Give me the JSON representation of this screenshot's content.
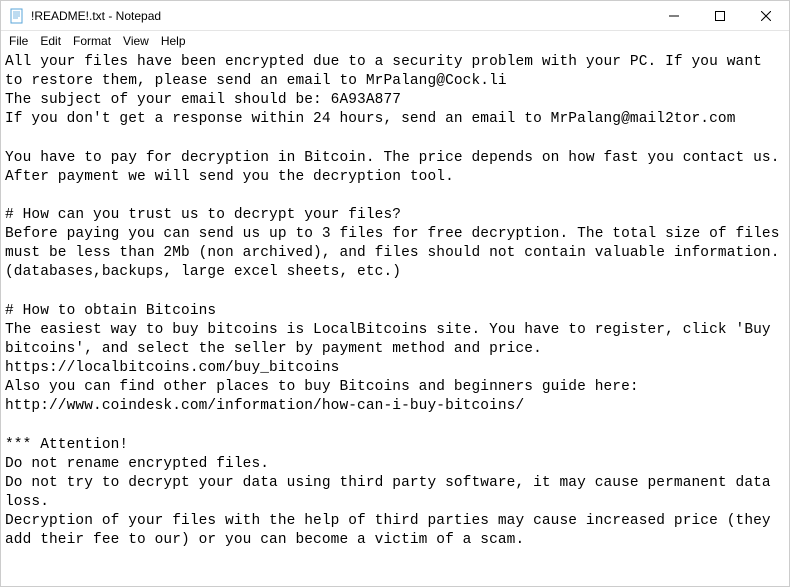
{
  "titlebar": {
    "title": "!README!.txt - Notepad"
  },
  "menubar": {
    "items": [
      "File",
      "Edit",
      "Format",
      "View",
      "Help"
    ]
  },
  "content": {
    "text": "All your files have been encrypted due to a security problem with your PC. If you want to restore them, please send an email to MrPalang@Cock.li\nThe subject of your email should be: 6A93A877\nIf you don't get a response within 24 hours, send an email to MrPalang@mail2tor.com\n\nYou have to pay for decryption in Bitcoin. The price depends on how fast you contact us. After payment we will send you the decryption tool.\n\n# How can you trust us to decrypt your files?\nBefore paying you can send us up to 3 files for free decryption. The total size of files must be less than 2Mb (non archived), and files should not contain valuable information. (databases,backups, large excel sheets, etc.)\n\n# How to obtain Bitcoins\nThe easiest way to buy bitcoins is LocalBitcoins site. You have to register, click 'Buy bitcoins', and select the seller by payment method and price.\nhttps://localbitcoins.com/buy_bitcoins\nAlso you can find other places to buy Bitcoins and beginners guide here:\nhttp://www.coindesk.com/information/how-can-i-buy-bitcoins/\n\n*** Attention!\nDo not rename encrypted files.\nDo not try to decrypt your data using third party software, it may cause permanent data loss.\nDecryption of your files with the help of third parties may cause increased price (they add their fee to our) or you can become a victim of a scam."
  }
}
